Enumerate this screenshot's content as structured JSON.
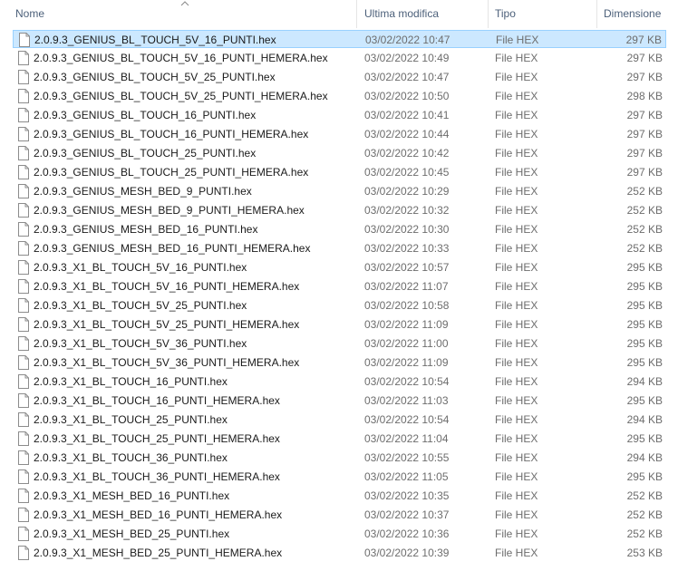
{
  "columns": {
    "name": "Nome",
    "modified": "Ultima modifica",
    "type": "Tipo",
    "size": "Dimensione"
  },
  "sort": {
    "column": "name",
    "direction": "ascending",
    "icon": "chevron-up-icon"
  },
  "file_icon": "generic-file-icon",
  "selected_index": 0,
  "files": [
    {
      "name": "2.0.9.3_GENIUS_BL_TOUCH_5V_16_PUNTI.hex",
      "modified": "03/02/2022 10:47",
      "type": "File HEX",
      "size": "297 KB"
    },
    {
      "name": "2.0.9.3_GENIUS_BL_TOUCH_5V_16_PUNTI_HEMERA.hex",
      "modified": "03/02/2022 10:49",
      "type": "File HEX",
      "size": "297 KB"
    },
    {
      "name": "2.0.9.3_GENIUS_BL_TOUCH_5V_25_PUNTI.hex",
      "modified": "03/02/2022 10:47",
      "type": "File HEX",
      "size": "297 KB"
    },
    {
      "name": "2.0.9.3_GENIUS_BL_TOUCH_5V_25_PUNTI_HEMERA.hex",
      "modified": "03/02/2022 10:50",
      "type": "File HEX",
      "size": "298 KB"
    },
    {
      "name": "2.0.9.3_GENIUS_BL_TOUCH_16_PUNTI.hex",
      "modified": "03/02/2022 10:41",
      "type": "File HEX",
      "size": "297 KB"
    },
    {
      "name": "2.0.9.3_GENIUS_BL_TOUCH_16_PUNTI_HEMERA.hex",
      "modified": "03/02/2022 10:44",
      "type": "File HEX",
      "size": "297 KB"
    },
    {
      "name": "2.0.9.3_GENIUS_BL_TOUCH_25_PUNTI.hex",
      "modified": "03/02/2022 10:42",
      "type": "File HEX",
      "size": "297 KB"
    },
    {
      "name": "2.0.9.3_GENIUS_BL_TOUCH_25_PUNTI_HEMERA.hex",
      "modified": "03/02/2022 10:45",
      "type": "File HEX",
      "size": "297 KB"
    },
    {
      "name": "2.0.9.3_GENIUS_MESH_BED_9_PUNTI.hex",
      "modified": "03/02/2022 10:29",
      "type": "File HEX",
      "size": "252 KB"
    },
    {
      "name": "2.0.9.3_GENIUS_MESH_BED_9_PUNTI_HEMERA.hex",
      "modified": "03/02/2022 10:32",
      "type": "File HEX",
      "size": "252 KB"
    },
    {
      "name": "2.0.9.3_GENIUS_MESH_BED_16_PUNTI.hex",
      "modified": "03/02/2022 10:30",
      "type": "File HEX",
      "size": "252 KB"
    },
    {
      "name": "2.0.9.3_GENIUS_MESH_BED_16_PUNTI_HEMERA.hex",
      "modified": "03/02/2022 10:33",
      "type": "File HEX",
      "size": "252 KB"
    },
    {
      "name": "2.0.9.3_X1_BL_TOUCH_5V_16_PUNTI.hex",
      "modified": "03/02/2022 10:57",
      "type": "File HEX",
      "size": "295 KB"
    },
    {
      "name": "2.0.9.3_X1_BL_TOUCH_5V_16_PUNTI_HEMERA.hex",
      "modified": "03/02/2022 11:07",
      "type": "File HEX",
      "size": "295 KB"
    },
    {
      "name": "2.0.9.3_X1_BL_TOUCH_5V_25_PUNTI.hex",
      "modified": "03/02/2022 10:58",
      "type": "File HEX",
      "size": "295 KB"
    },
    {
      "name": "2.0.9.3_X1_BL_TOUCH_5V_25_PUNTI_HEMERA.hex",
      "modified": "03/02/2022 11:09",
      "type": "File HEX",
      "size": "295 KB"
    },
    {
      "name": "2.0.9.3_X1_BL_TOUCH_5V_36_PUNTI.hex",
      "modified": "03/02/2022 11:00",
      "type": "File HEX",
      "size": "295 KB"
    },
    {
      "name": "2.0.9.3_X1_BL_TOUCH_5V_36_PUNTI_HEMERA.hex",
      "modified": "03/02/2022 11:09",
      "type": "File HEX",
      "size": "295 KB"
    },
    {
      "name": "2.0.9.3_X1_BL_TOUCH_16_PUNTI.hex",
      "modified": "03/02/2022 10:54",
      "type": "File HEX",
      "size": "294 KB"
    },
    {
      "name": "2.0.9.3_X1_BL_TOUCH_16_PUNTI_HEMERA.hex",
      "modified": "03/02/2022 11:03",
      "type": "File HEX",
      "size": "295 KB"
    },
    {
      "name": "2.0.9.3_X1_BL_TOUCH_25_PUNTI.hex",
      "modified": "03/02/2022 10:54",
      "type": "File HEX",
      "size": "294 KB"
    },
    {
      "name": "2.0.9.3_X1_BL_TOUCH_25_PUNTI_HEMERA.hex",
      "modified": "03/02/2022 11:04",
      "type": "File HEX",
      "size": "295 KB"
    },
    {
      "name": "2.0.9.3_X1_BL_TOUCH_36_PUNTI.hex",
      "modified": "03/02/2022 10:55",
      "type": "File HEX",
      "size": "294 KB"
    },
    {
      "name": "2.0.9.3_X1_BL_TOUCH_36_PUNTI_HEMERA.hex",
      "modified": "03/02/2022 11:05",
      "type": "File HEX",
      "size": "295 KB"
    },
    {
      "name": "2.0.9.3_X1_MESH_BED_16_PUNTI.hex",
      "modified": "03/02/2022 10:35",
      "type": "File HEX",
      "size": "252 KB"
    },
    {
      "name": "2.0.9.3_X1_MESH_BED_16_PUNTI_HEMERA.hex",
      "modified": "03/02/2022 10:37",
      "type": "File HEX",
      "size": "252 KB"
    },
    {
      "name": "2.0.9.3_X1_MESH_BED_25_PUNTI.hex",
      "modified": "03/02/2022 10:36",
      "type": "File HEX",
      "size": "252 KB"
    },
    {
      "name": "2.0.9.3_X1_MESH_BED_25_PUNTI_HEMERA.hex",
      "modified": "03/02/2022 10:39",
      "type": "File HEX",
      "size": "253 KB"
    }
  ]
}
